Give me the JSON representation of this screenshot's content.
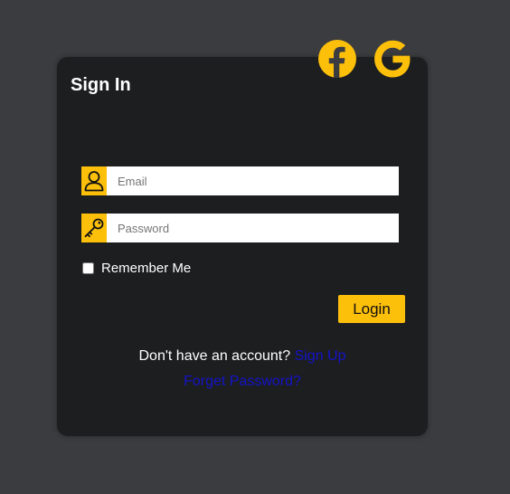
{
  "colors": {
    "page_bg": "#3b3c3f",
    "card_bg": "#1d1e20",
    "accent": "#fcbf0a",
    "link": "#1414c8",
    "text": "#ffffff"
  },
  "header": {
    "title": "Sign In"
  },
  "social": [
    {
      "icon": "facebook-icon"
    },
    {
      "icon": "google-icon"
    }
  ],
  "form": {
    "email": {
      "icon": "user-icon",
      "placeholder": "Email",
      "value": ""
    },
    "password": {
      "icon": "key-icon",
      "placeholder": "Password",
      "value": ""
    },
    "remember_label": "Remember Me",
    "remember_checked": false,
    "login_label": "Login"
  },
  "footer": {
    "no_account_text": "Don't have an account?",
    "signup_link": "Sign Up",
    "forgot_link": "Forget Password?"
  }
}
